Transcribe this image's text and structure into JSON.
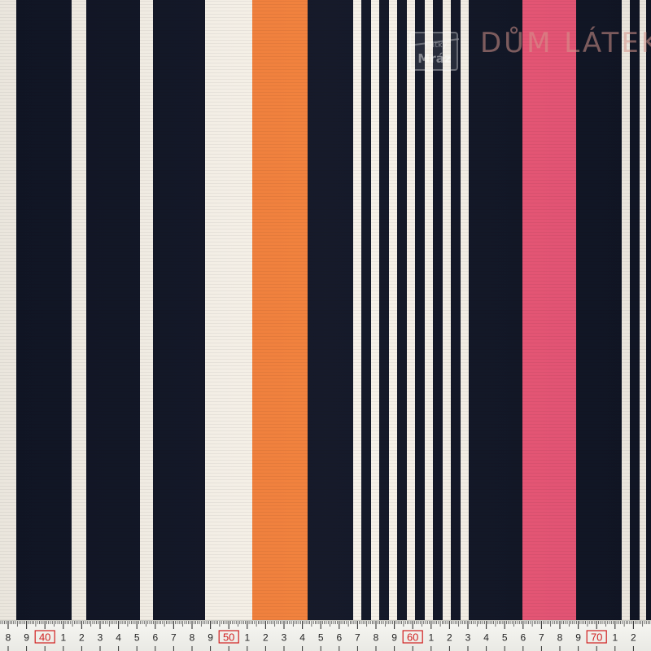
{
  "image": {
    "subject": "striped fabric swatch",
    "colors": {
      "navy": "#111626",
      "cream": "#f7f2e9",
      "orange": "#f2803b",
      "pink": "#ec5778",
      "ruler_bg": "#f4f4ef",
      "ruler_red": "#d11f1f",
      "ruler_text": "#222222"
    },
    "watermarks": {
      "mraz_top": "Látky",
      "mraz_bottom": "Mráz",
      "dum_latek": "DŮM LÁTEK.CZ"
    }
  },
  "ruler": {
    "labels": [
      {
        "text": "8",
        "major": false
      },
      {
        "text": "9",
        "major": false
      },
      {
        "text": "40",
        "major": true
      },
      {
        "text": "1",
        "major": false
      },
      {
        "text": "2",
        "major": false
      },
      {
        "text": "3",
        "major": false
      },
      {
        "text": "4",
        "major": false
      },
      {
        "text": "5",
        "major": false
      },
      {
        "text": "6",
        "major": false
      },
      {
        "text": "7",
        "major": false
      },
      {
        "text": "8",
        "major": false
      },
      {
        "text": "9",
        "major": false
      },
      {
        "text": "50",
        "major": true
      },
      {
        "text": "1",
        "major": false
      },
      {
        "text": "2",
        "major": false
      },
      {
        "text": "3",
        "major": false
      },
      {
        "text": "4",
        "major": false
      },
      {
        "text": "5",
        "major": false
      },
      {
        "text": "6",
        "major": false
      },
      {
        "text": "7",
        "major": false
      },
      {
        "text": "8",
        "major": false
      },
      {
        "text": "9",
        "major": false
      },
      {
        "text": "60",
        "major": true
      },
      {
        "text": "1",
        "major": false
      },
      {
        "text": "2",
        "major": false
      },
      {
        "text": "3",
        "major": false
      },
      {
        "text": "4",
        "major": false
      },
      {
        "text": "5",
        "major": false
      },
      {
        "text": "6",
        "major": false
      },
      {
        "text": "7",
        "major": false
      },
      {
        "text": "8",
        "major": false
      },
      {
        "text": "9",
        "major": false
      },
      {
        "text": "70",
        "major": true
      },
      {
        "text": "1",
        "major": false
      },
      {
        "text": "2",
        "major": false
      }
    ]
  }
}
